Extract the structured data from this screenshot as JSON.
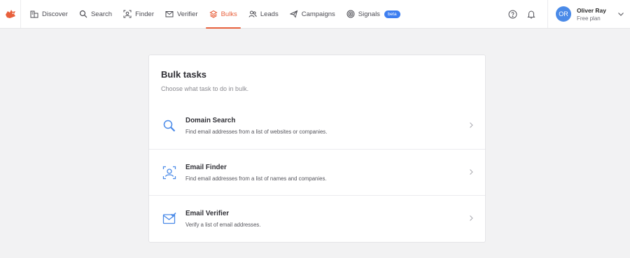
{
  "nav": {
    "items": [
      {
        "label": "Discover",
        "icon": "discover-icon"
      },
      {
        "label": "Search",
        "icon": "search-icon"
      },
      {
        "label": "Finder",
        "icon": "finder-icon"
      },
      {
        "label": "Verifier",
        "icon": "verifier-icon"
      },
      {
        "label": "Bulks",
        "icon": "bulks-icon",
        "active": true
      },
      {
        "label": "Leads",
        "icon": "leads-icon"
      },
      {
        "label": "Campaigns",
        "icon": "campaigns-icon"
      },
      {
        "label": "Signals",
        "icon": "signals-icon",
        "badge": "beta"
      }
    ],
    "active_color": "#e8603c",
    "badge_color": "#3d7ef0"
  },
  "user": {
    "initials": "OR",
    "name": "Oliver Ray",
    "plan": "Free plan"
  },
  "tools": [
    "help-icon",
    "bell-icon",
    "chevron-down-icon"
  ],
  "bulk": {
    "title": "Bulk tasks",
    "subtitle": "Choose what task to do in bulk.",
    "tasks": [
      {
        "name": "Domain Search",
        "description": "Find email addresses from a list of websites or companies.",
        "icon": "magnifier-icon"
      },
      {
        "name": "Email Finder",
        "description": "Find email addresses from a list of names and companies.",
        "icon": "person-frame-icon"
      },
      {
        "name": "Email Verifier",
        "description": "Verify a list of email addresses.",
        "icon": "envelope-check-icon"
      }
    ]
  },
  "colors": {
    "accent_blue": "#4a8ae8",
    "background": "#f2f2f3"
  }
}
